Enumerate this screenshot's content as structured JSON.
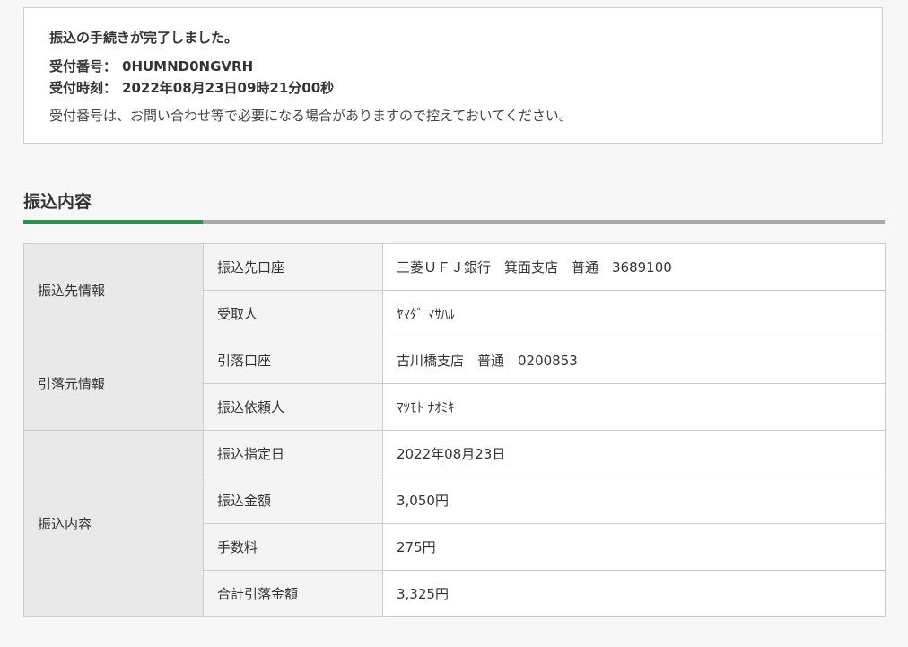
{
  "notice": {
    "title": "振込の手続きが完了しました。",
    "receipt_number_label": "受付番号：",
    "receipt_number": "0HUMND0NGVRH",
    "receipt_time_label": "受付時刻：",
    "receipt_time": "2022年08月23日09時21分00秒",
    "note": "受付番号は、お問い合わせ等で必要になる場合がありますので控えておいてください。"
  },
  "section": {
    "title": "振込内容",
    "accent_color": "#2f8f4e"
  },
  "details": {
    "groups": [
      {
        "label": "振込先情報",
        "rows": [
          {
            "label": "振込先口座",
            "value": "三菱ＵＦＪ銀行　箕面支店　普通　3689100"
          },
          {
            "label": "受取人",
            "value": "ﾔﾏﾀﾞ ﾏｻﾊﾙ"
          }
        ]
      },
      {
        "label": "引落元情報",
        "rows": [
          {
            "label": "引落口座",
            "value": "古川橋支店　普通　0200853"
          },
          {
            "label": "振込依頼人",
            "value": "ﾏﾂﾓﾄ ﾅｵﾐｷ"
          }
        ]
      },
      {
        "label": "振込内容",
        "rows": [
          {
            "label": "振込指定日",
            "value": "2022年08月23日"
          },
          {
            "label": "振込金額",
            "value": "3,050円"
          },
          {
            "label": "手数料",
            "value": "275円"
          },
          {
            "label": "合計引落金額",
            "value": "3,325円"
          }
        ]
      }
    ]
  }
}
